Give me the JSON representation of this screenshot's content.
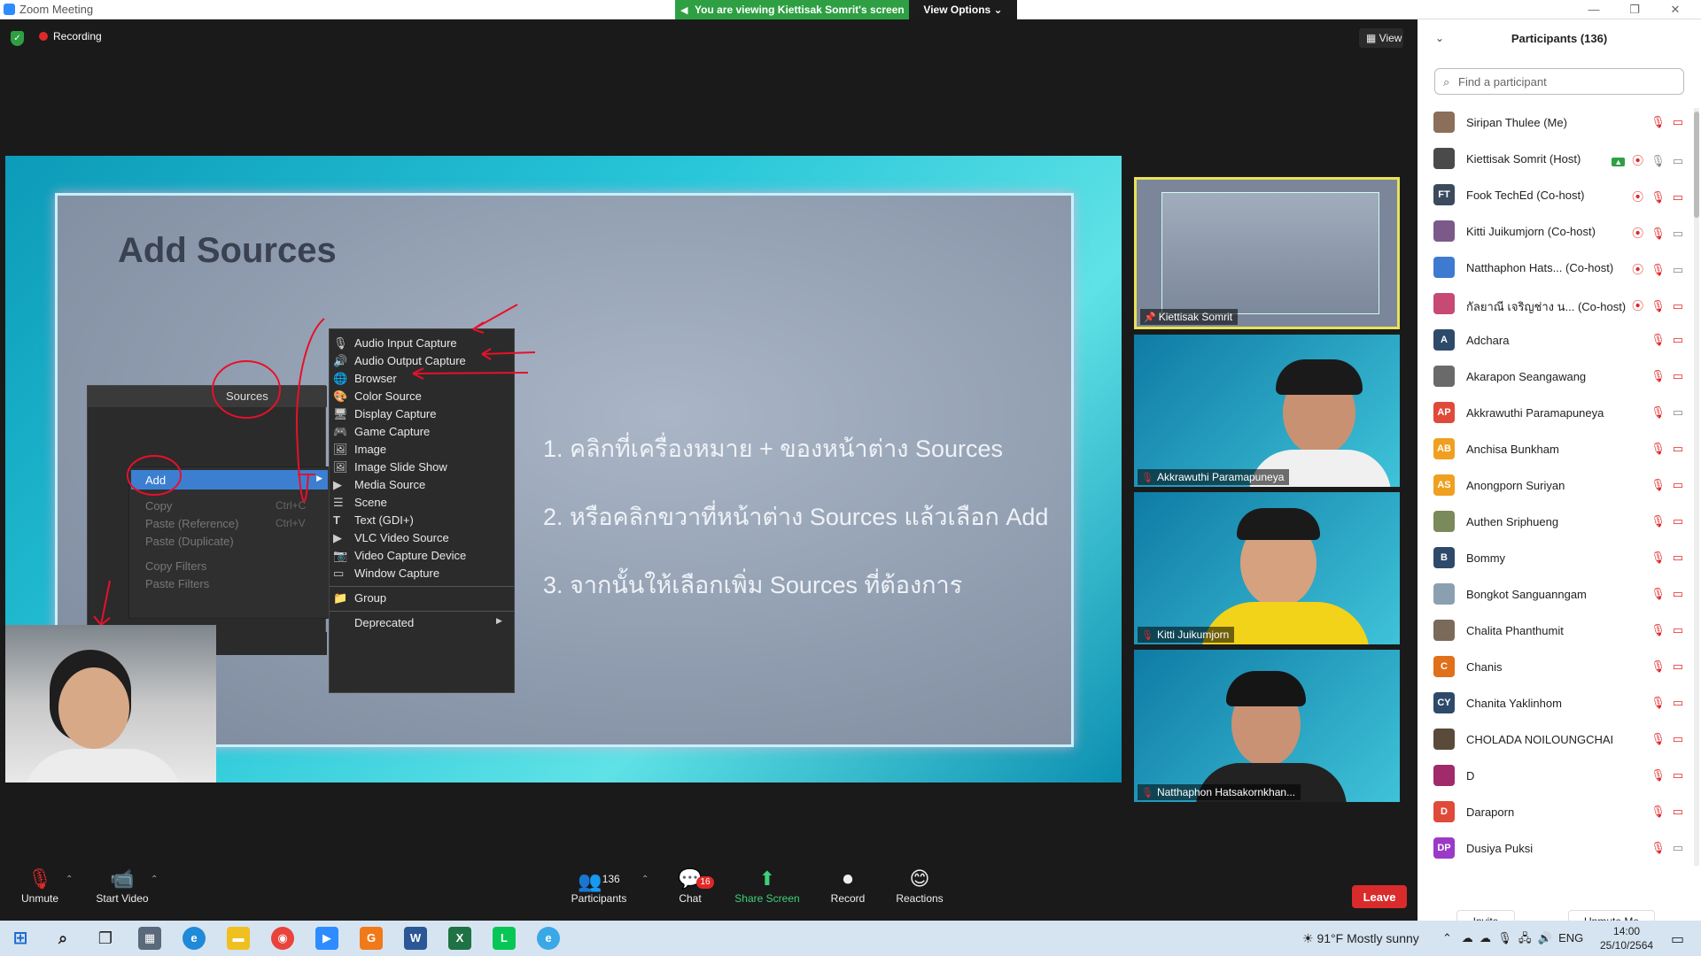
{
  "window": {
    "title": "Zoom Meeting",
    "minimize": "—",
    "maximize": "❐",
    "close": "✕"
  },
  "share_banner": {
    "message": "You are viewing Kiettisak Somrit's screen",
    "view_options": "View Options ⌄"
  },
  "meeting": {
    "recording": "Recording",
    "view": "View"
  },
  "slide": {
    "title": "Add Sources",
    "steps": [
      "1.  คลิกที่เครื่องหมาย + ของหน้าต่าง Sources",
      "2.  หรือคลิกขวาที่หน้าต่าง Sources แล้วเลือก Add",
      "3.  จากนั้นให้เลือกเพิ่ม Sources ที่ต้องการ"
    ],
    "obs_panel_header": "Sources",
    "context_menu": {
      "add": "Add",
      "items": [
        {
          "label": "Copy",
          "shortcut": "Ctrl+C"
        },
        {
          "label": "Paste (Reference)",
          "shortcut": "Ctrl+V"
        },
        {
          "label": "Paste (Duplicate)",
          "shortcut": ""
        },
        {
          "label": "Copy Filters",
          "shortcut": ""
        },
        {
          "label": "Paste Filters",
          "shortcut": ""
        }
      ]
    },
    "sources_menu": [
      "Audio Input Capture",
      "Audio Output Capture",
      "Browser",
      "Color Source",
      "Display Capture",
      "Game Capture",
      "Image",
      "Image Slide Show",
      "Media Source",
      "Scene",
      "Text (GDI+)",
      "VLC Video Source",
      "Video Capture Device",
      "Window Capture",
      "Group",
      "Deprecated"
    ]
  },
  "tiles": [
    {
      "name": "Kiettisak Somrit"
    },
    {
      "name": "Akkrawuthi Paramapuneya"
    },
    {
      "name": "Kitti Juikumjorn"
    },
    {
      "name": "Natthaphon Hatsakornkhan..."
    }
  ],
  "participants": {
    "title": "Participants (136)",
    "search_placeholder": "Find a participant",
    "list": [
      {
        "name": "Siripan Thulee (Me)",
        "initials": "",
        "color": "#8b6f5a"
      },
      {
        "name": "Kiettisak Somrit (Host)",
        "initials": "",
        "color": "#4a4a4a"
      },
      {
        "name": "Fook TechEd (Co-host)",
        "initials": "FT",
        "color": "#3b4a5c"
      },
      {
        "name": "Kitti Juikumjorn (Co-host)",
        "initials": "",
        "color": "#7b5a8a"
      },
      {
        "name": "Natthaphon Hats... (Co-host)",
        "initials": "",
        "color": "#3f7ad1"
      },
      {
        "name": "กัลยาณี เจริญช่าง น... (Co-host)",
        "initials": "",
        "color": "#c74a74"
      },
      {
        "name": "Adchara",
        "initials": "A",
        "color": "#2e4a6b"
      },
      {
        "name": "Akarapon Seangawang",
        "initials": "",
        "color": "#6a6a6a"
      },
      {
        "name": "Akkrawuthi Paramapuneya",
        "initials": "AP",
        "color": "#e04a3a"
      },
      {
        "name": "Anchisa Bunkham",
        "initials": "AB",
        "color": "#f0a020"
      },
      {
        "name": "Anongporn Suriyan",
        "initials": "AS",
        "color": "#f0a020"
      },
      {
        "name": "Authen Sriphueng",
        "initials": "",
        "color": "#7a8a5a"
      },
      {
        "name": "Bommy",
        "initials": "B",
        "color": "#2e4a6b"
      },
      {
        "name": "Bongkot Sanguanngam",
        "initials": "",
        "color": "#8aa0b0"
      },
      {
        "name": "Chalita Phanthumit",
        "initials": "",
        "color": "#7a6a5a"
      },
      {
        "name": "Chanis",
        "initials": "C",
        "color": "#e0701a"
      },
      {
        "name": "Chanita Yaklinhom",
        "initials": "CY",
        "color": "#2e4a6b"
      },
      {
        "name": "CHOLADA NOILOUNGCHAI",
        "initials": "",
        "color": "#5a4a3a"
      },
      {
        "name": "D",
        "initials": "",
        "color": "#a02a6a"
      },
      {
        "name": "Daraporn",
        "initials": "D",
        "color": "#e04a3a"
      },
      {
        "name": "Dusiya Puksi",
        "initials": "DP",
        "color": "#9a3ac7"
      }
    ],
    "invite": "Invite",
    "unmute_me": "Unmute Me"
  },
  "toolbar": {
    "unmute": "Unmute",
    "start_video": "Start Video",
    "participants": "Participants",
    "participants_count": "136",
    "chat": "Chat",
    "chat_badge": "16",
    "share_screen": "Share Screen",
    "record": "Record",
    "reactions": "Reactions",
    "leave": "Leave"
  },
  "taskbar": {
    "weather": "91°F  Mostly sunny",
    "lang": "ENG",
    "time": "14:00",
    "date": "25/10/2564"
  }
}
